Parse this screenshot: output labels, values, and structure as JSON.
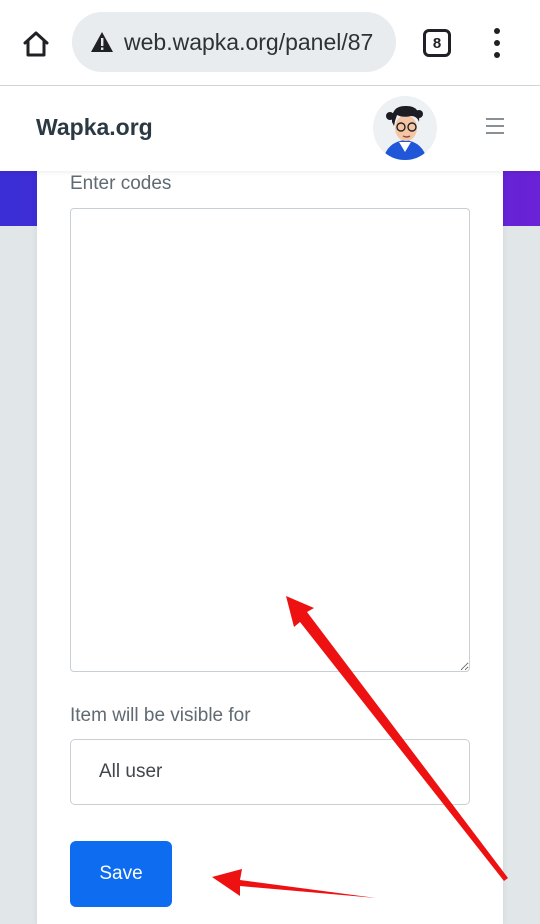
{
  "browser": {
    "url": "web.wapka.org/panel/87",
    "tab_count": "8",
    "icons": [
      "home-icon",
      "warning-icon",
      "tab-switcher-icon",
      "more-vert-icon"
    ]
  },
  "site": {
    "brand": "Wapka.org",
    "icons": [
      "avatar",
      "hamburger-icon"
    ]
  },
  "form": {
    "codes_label": "Enter codes",
    "codes_value": "",
    "visibility_label": "Item will be visible for",
    "visibility_value": "All user",
    "save_label": "Save"
  },
  "colors": {
    "accent": "#0d6cf0",
    "hero_band": "#4a2ad8",
    "annotation_arrow": "#ee1111"
  }
}
